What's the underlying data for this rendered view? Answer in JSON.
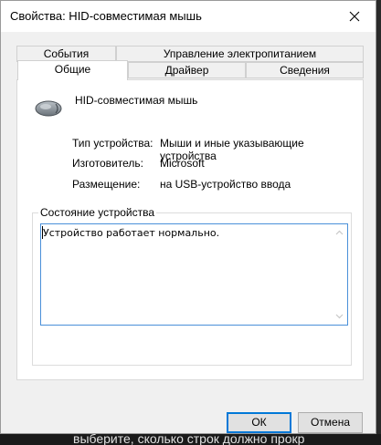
{
  "window": {
    "title": "Свойства: HID-совместимая мышь"
  },
  "tabs": {
    "row1": [
      "События",
      "Управление электропитанием"
    ],
    "row2": [
      "Общие",
      "Драйвер",
      "Сведения"
    ],
    "active": "Общие"
  },
  "general": {
    "device_icon": "mouse-icon",
    "device_name": "HID-совместимая мышь",
    "properties": [
      {
        "label": "Тип устройства:",
        "value": "Мыши и иные указывающие устройства"
      },
      {
        "label": "Изготовитель:",
        "value": "Microsoft"
      },
      {
        "label": "Размещение:",
        "value": "на USB-устройство ввода"
      }
    ],
    "status_group_label": "Состояние устройства",
    "status_text": "Устройство работает нормально."
  },
  "buttons": {
    "ok": "ОК",
    "cancel": "Отмена"
  },
  "background": {
    "text": "выберите, сколько строк должно прокр"
  }
}
